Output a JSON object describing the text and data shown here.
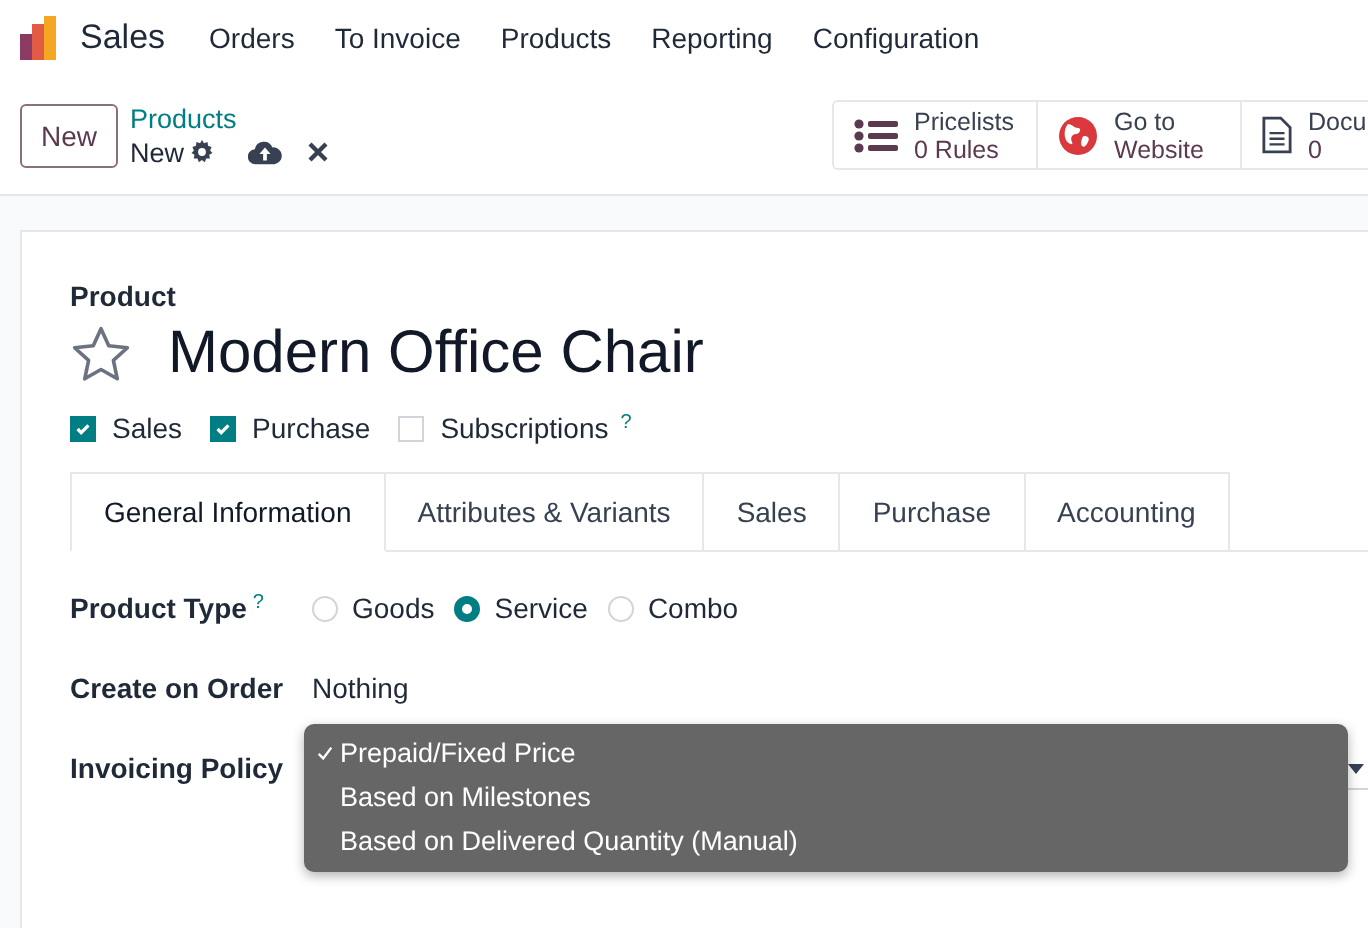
{
  "app": {
    "name": "Sales"
  },
  "menu": [
    "Orders",
    "To Invoice",
    "Products",
    "Reporting",
    "Configuration"
  ],
  "control_panel": {
    "new_button": "New",
    "breadcrumb": "Products",
    "record": "New",
    "stat_buttons": [
      {
        "kind": "list",
        "label": "Pricelists",
        "sublabel": "0 Rules"
      },
      {
        "kind": "globe",
        "label": "Go to",
        "sublabel": "Website"
      },
      {
        "kind": "document",
        "label": "Docu",
        "sublabel": "0"
      }
    ]
  },
  "form": {
    "field_label": "Product",
    "name": "Modern Office Chair",
    "favorite": false,
    "options": [
      {
        "label": "Sales",
        "checked": true
      },
      {
        "label": "Purchase",
        "checked": true
      },
      {
        "label": "Subscriptions",
        "checked": false,
        "help": "?"
      }
    ],
    "tabs": [
      {
        "label": "General Information",
        "selected": true
      },
      {
        "label": "Attributes & Variants",
        "selected": false
      },
      {
        "label": "Sales",
        "selected": false
      },
      {
        "label": "Purchase",
        "selected": false
      },
      {
        "label": "Accounting",
        "selected": false
      }
    ],
    "fields": [
      {
        "kind": "radio",
        "label": "Product Type",
        "help": "?",
        "options": [
          {
            "label": "Goods",
            "selected": false
          },
          {
            "label": "Service",
            "selected": true
          },
          {
            "label": "Combo",
            "selected": false
          }
        ]
      },
      {
        "kind": "text",
        "label": "Create on Order",
        "value": "Nothing"
      },
      {
        "kind": "select",
        "label": "Invoicing Policy",
        "menu": [
          {
            "label": "Prepaid/Fixed Price",
            "selected": true
          },
          {
            "label": "Based on Milestones",
            "selected": false
          },
          {
            "label": "Based on Delivered Quantity (Manual)",
            "selected": false
          }
        ]
      }
    ]
  }
}
